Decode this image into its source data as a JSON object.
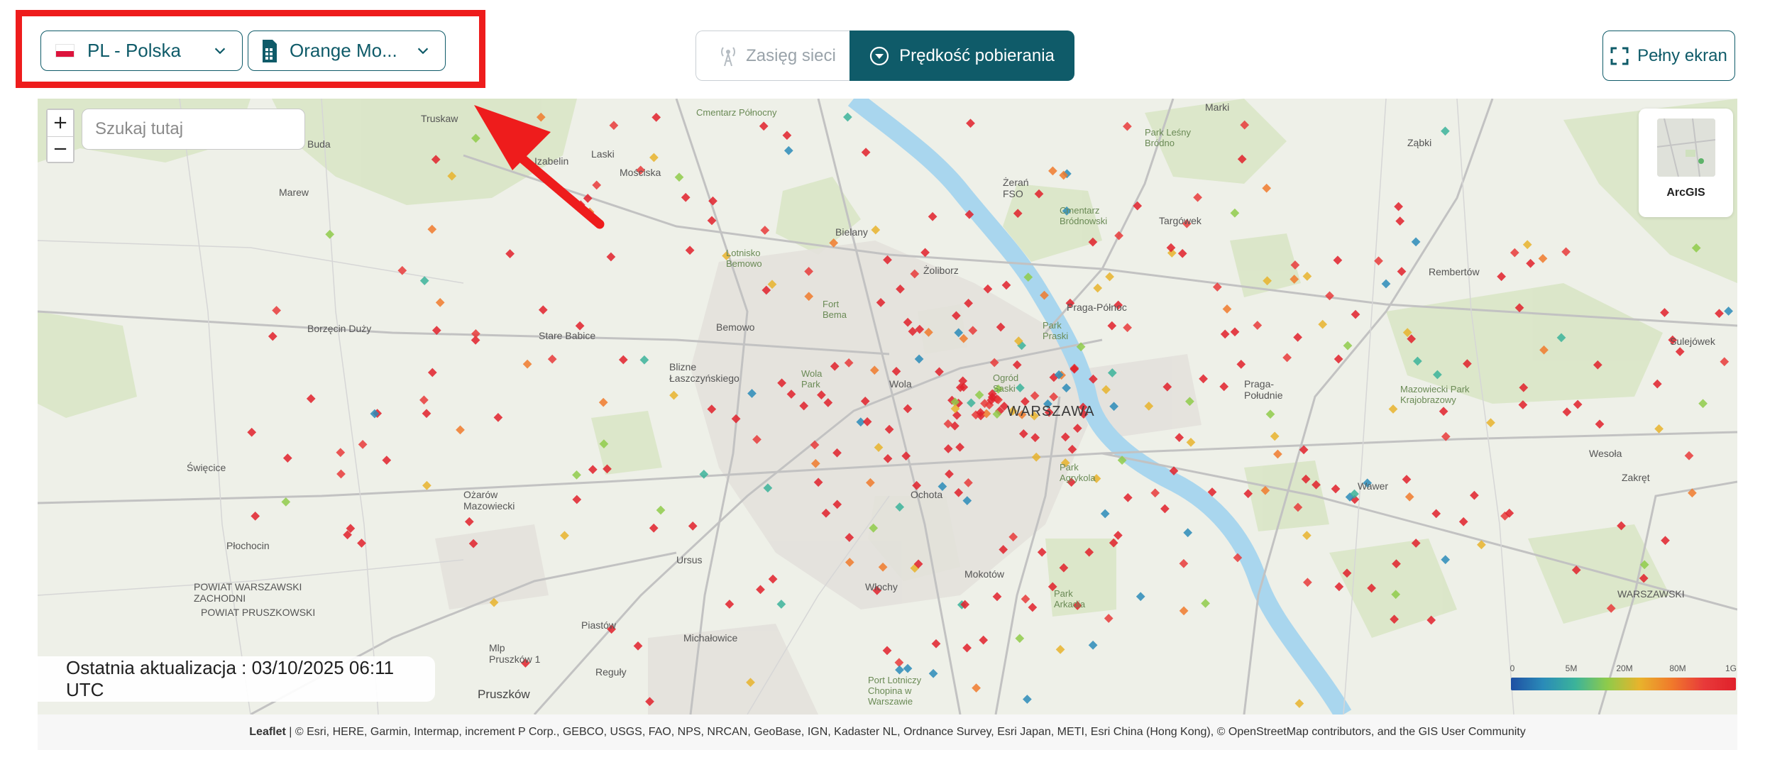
{
  "controls": {
    "country": {
      "label": "PL - Polska"
    },
    "operator": {
      "label": "Orange Mo..."
    }
  },
  "view_toggle": {
    "coverage_label": "Zasięg sieci",
    "speed_label": "Prędkość pobierania",
    "active": "speed"
  },
  "fullscreen_label": "Pełny ekran",
  "search": {
    "placeholder": "Szukaj tutaj"
  },
  "zoom": {
    "in": "+",
    "out": "−"
  },
  "basemap": {
    "label": "ArcGIS"
  },
  "last_update": "Ostatnia aktualizacja : 03/10/2025 06:11 UTC",
  "legend": {
    "ticks": [
      "0",
      "5M",
      "20M",
      "80M",
      "1G"
    ],
    "colors": [
      "#1f4fa3",
      "#2a8bb8",
      "#3bb39a",
      "#8fcb4a",
      "#e8b32c",
      "#f07a2b",
      "#e83a3a",
      "#e0202a"
    ]
  },
  "attribution": {
    "leaflet": "Leaflet",
    "text": " | © Esri, HERE, Garmin, Intermap, increment P Corp., GEBCO, USGS, FAO, NPS, NRCAN, GeoBase, IGN, Kadaster NL, Ordnance Survey, Esri Japan, METI, Esri China (Hong Kong), © OpenStreetMap contributors, and the GIS User Community"
  },
  "places": {
    "warszawa": "WARSZAWA",
    "truskaw": "Truskaw",
    "buda": "Buda",
    "izabelin": "Izabelin",
    "laski": "Laski",
    "mosciska": "Mościska",
    "cmentarz_polnocny": "Cmentarz Północny",
    "marki": "Marki",
    "park_lesny_brodno": "Park Leśny Bródno",
    "zabki": "Ząbki",
    "bielany": "Bielany",
    "zeran": "Żerań FSO",
    "cmentarz_brodnowski": "Cmentarz Bródnowski",
    "targowek": "Targówek",
    "marew": "Marew",
    "lotnisko_bemowo": "Lotnisko Bemowo",
    "zoliborz": "Żoliborz",
    "rembertow": "Rembertów",
    "borzecin_duzy": "Borzęcin Duży",
    "stare_babice": "Stare Babice",
    "bemowo": "Bemowo",
    "fort_bema": "Fort Bema",
    "praga_polnoc": "Praga-Północ",
    "park_praski": "Park Praski",
    "sulejowek": "Sulejówek",
    "blizne": "Blizne Łaszczyńskiego",
    "wola_park": "Wola Park",
    "wola": "Wola",
    "ogrod_saski": "Ogród Saski",
    "praga_poludnie": "Praga-Południe",
    "mazowiecki_park": "Mazowiecki Park Krajobrazowy",
    "swiecice": "Święcice",
    "ozarow": "Ożarów Mazowiecki",
    "park_agrykola": "Park Agrykola",
    "waver": "Wawer",
    "wesola": "Wesoła",
    "zakret": "Zakręt",
    "ochota": "Ochota",
    "plochocin": "Płochocin",
    "ursus": "Ursus",
    "powiat_warszawski": "POWIAT WARSZAWSKI ZACHODNI",
    "powiat_pruszkowski": "POWIAT PRUSZKOWSKI",
    "wlochy": "Włochy",
    "mokotow": "Mokotów",
    "park_arkadia": "Park Arkadia",
    "piastow": "Piastów",
    "michalowice": "Michałowice",
    "mp_pruszkow": "Mlp Pruszków 1",
    "reguly": "Reguły",
    "pruszkow": "Pruszków",
    "port_lotniczy": "Port Lotniczy Chopina w Warszawie",
    "powiat_warszawski_e": "WARSZAWSKI"
  }
}
